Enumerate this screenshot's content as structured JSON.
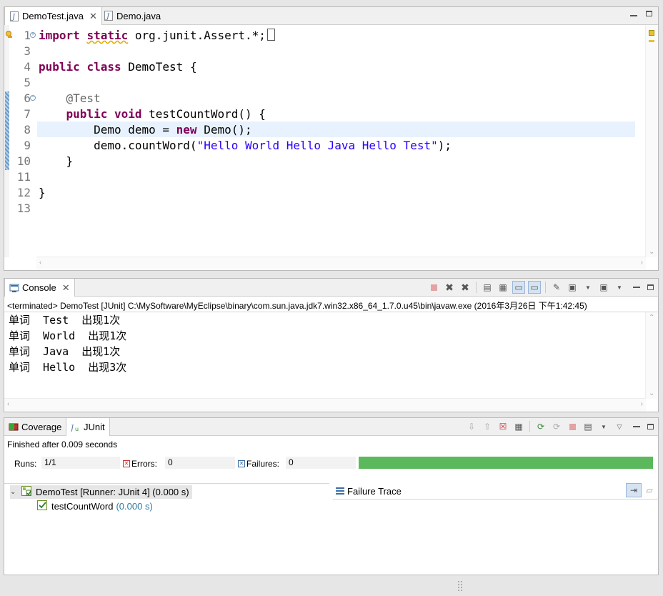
{
  "editor": {
    "tabs": [
      {
        "label": "DemoTest.java",
        "active": true
      },
      {
        "label": "Demo.java",
        "active": false
      }
    ],
    "lines": [
      {
        "num": "1",
        "parts": [
          [
            "kw",
            "import"
          ],
          [
            "p",
            " "
          ],
          [
            "kw",
            "static"
          ],
          [
            "p",
            " org.junit.Assert.*;"
          ]
        ]
      },
      {
        "num": "3",
        "parts": []
      },
      {
        "num": "4",
        "parts": [
          [
            "kw",
            "public"
          ],
          [
            "p",
            " "
          ],
          [
            "kw",
            "class"
          ],
          [
            "p",
            " DemoTest {"
          ]
        ]
      },
      {
        "num": "5",
        "parts": []
      },
      {
        "num": "6",
        "parts": [
          [
            "p",
            "    "
          ],
          [
            "ann",
            "@Test"
          ]
        ]
      },
      {
        "num": "7",
        "parts": [
          [
            "p",
            "    "
          ],
          [
            "kw",
            "public"
          ],
          [
            "p",
            " "
          ],
          [
            "kw",
            "void"
          ],
          [
            "p",
            " testCountWord() {"
          ]
        ]
      },
      {
        "num": "8",
        "parts": [
          [
            "p",
            "        Demo demo = "
          ],
          [
            "kw",
            "new"
          ],
          [
            "p",
            " Demo();"
          ]
        ]
      },
      {
        "num": "9",
        "parts": [
          [
            "p",
            "        demo.countWord("
          ],
          [
            "str",
            "\"Hello World Hello Java Hello Test\""
          ],
          [
            "p",
            ");"
          ]
        ]
      },
      {
        "num": "10",
        "parts": [
          [
            "p",
            "    }"
          ]
        ]
      },
      {
        "num": "11",
        "parts": []
      },
      {
        "num": "12",
        "parts": [
          [
            "p",
            "}"
          ]
        ]
      },
      {
        "num": "13",
        "parts": []
      }
    ]
  },
  "console": {
    "tab_label": "Console",
    "header": "<terminated> DemoTest [JUnit] C:\\MySoftware\\MyEclipse\\binary\\com.sun.java.jdk7.win32.x86_64_1.7.0.u45\\bin\\javaw.exe (2016年3月26日 下午1:42:45)",
    "output": [
      "单词  Test  出现1次",
      "单词  World  出现1次",
      "单词  Java  出现1次",
      "单词  Hello  出现3次"
    ]
  },
  "junit": {
    "tabs": [
      {
        "label": "Coverage",
        "active": false
      },
      {
        "label": "JUnit",
        "active": true
      }
    ],
    "finished": "Finished after 0.009 seconds",
    "runs_label": "Runs:",
    "runs_value": "1/1",
    "errors_label": "Errors:",
    "errors_value": "0",
    "failures_label": "Failures:",
    "failures_value": "0",
    "progress_fraction": 1.0,
    "root_label": "DemoTest [Runner: JUnit 4] (0.000 s)",
    "child_label": "testCountWord",
    "child_duration": "(0.000 s)",
    "failure_trace_label": "Failure Trace"
  },
  "colors": {
    "keyword": "#7f0055",
    "string": "#2a00ff",
    "annotation": "#646464",
    "progress_ok": "#5cb85c"
  }
}
